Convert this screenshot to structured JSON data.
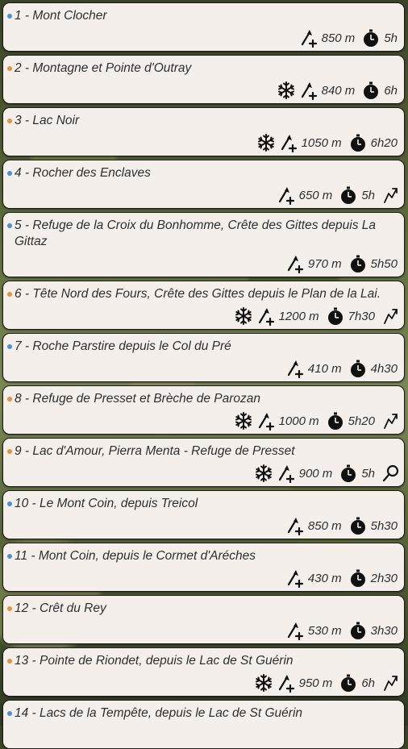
{
  "colors": {
    "blue": "#4a90d9",
    "orange": "#e8923a"
  },
  "icons": {
    "snow": "snowflake-icon",
    "elevation": "elevation-gain-icon",
    "duration": "stopwatch-icon",
    "traverse": "traverse-arrow-icon",
    "search": "magnifier-icon"
  },
  "routes": [
    {
      "title": "1 - Mont Clocher",
      "dot": "blue",
      "snow": false,
      "elevation": "850 m",
      "duration": "5h",
      "extra": null
    },
    {
      "title": "2 - Montagne et Pointe d'Outray",
      "dot": "orange",
      "snow": true,
      "elevation": "840 m",
      "duration": "6h",
      "extra": null
    },
    {
      "title": "3 - Lac Noir",
      "dot": "orange",
      "snow": true,
      "elevation": "1050 m",
      "duration": "6h20",
      "extra": null
    },
    {
      "title": "4 - Rocher des Enclaves",
      "dot": "blue",
      "snow": false,
      "elevation": "650 m",
      "duration": "5h",
      "extra": "traverse"
    },
    {
      "title": "5 - Refuge de la Croix du Bonhomme, Crête des Gittes depuis La Gittaz",
      "dot": "blue",
      "snow": false,
      "elevation": "970 m",
      "duration": "5h50",
      "extra": null
    },
    {
      "title": "6 - Tête Nord des Fours, Crête des Gittes depuis le Plan de la Lai.",
      "dot": "orange",
      "snow": true,
      "elevation": "1200 m",
      "duration": "7h30",
      "extra": "traverse"
    },
    {
      "title": "7 - Roche Parstire depuis le Col du Pré",
      "dot": "blue",
      "snow": false,
      "elevation": "410 m",
      "duration": "4h30",
      "extra": null
    },
    {
      "title": "8 - Refuge de Presset et Brèche de Parozan",
      "dot": "orange",
      "snow": true,
      "elevation": "1000 m",
      "duration": "5h20",
      "extra": "traverse"
    },
    {
      "title": "9 - Lac d'Amour, Pierra Menta - Refuge de Presset",
      "dot": "orange",
      "snow": true,
      "elevation": "900 m",
      "duration": "5h",
      "extra": "search"
    },
    {
      "title": "10 - Le Mont Coin, depuis Treicol",
      "dot": "blue",
      "snow": false,
      "elevation": "850 m",
      "duration": "5h30",
      "extra": null
    },
    {
      "title": "11 - Mont Coin, depuis le Cormet d'Aréches",
      "dot": "blue",
      "snow": false,
      "elevation": "430 m",
      "duration": "2h30",
      "extra": null
    },
    {
      "title": "12 - Crêt du Rey",
      "dot": "orange",
      "snow": false,
      "elevation": "530 m",
      "duration": "3h30",
      "extra": null
    },
    {
      "title": "13 - Pointe de Riondet, depuis le Lac de St Guérin",
      "dot": "orange",
      "snow": true,
      "elevation": "950 m",
      "duration": "6h",
      "extra": "traverse"
    },
    {
      "title": "14 - Lacs de la Tempête, depuis le Lac de St Guérin",
      "dot": "blue",
      "snow": false,
      "elevation": "",
      "duration": "",
      "extra": null
    }
  ]
}
